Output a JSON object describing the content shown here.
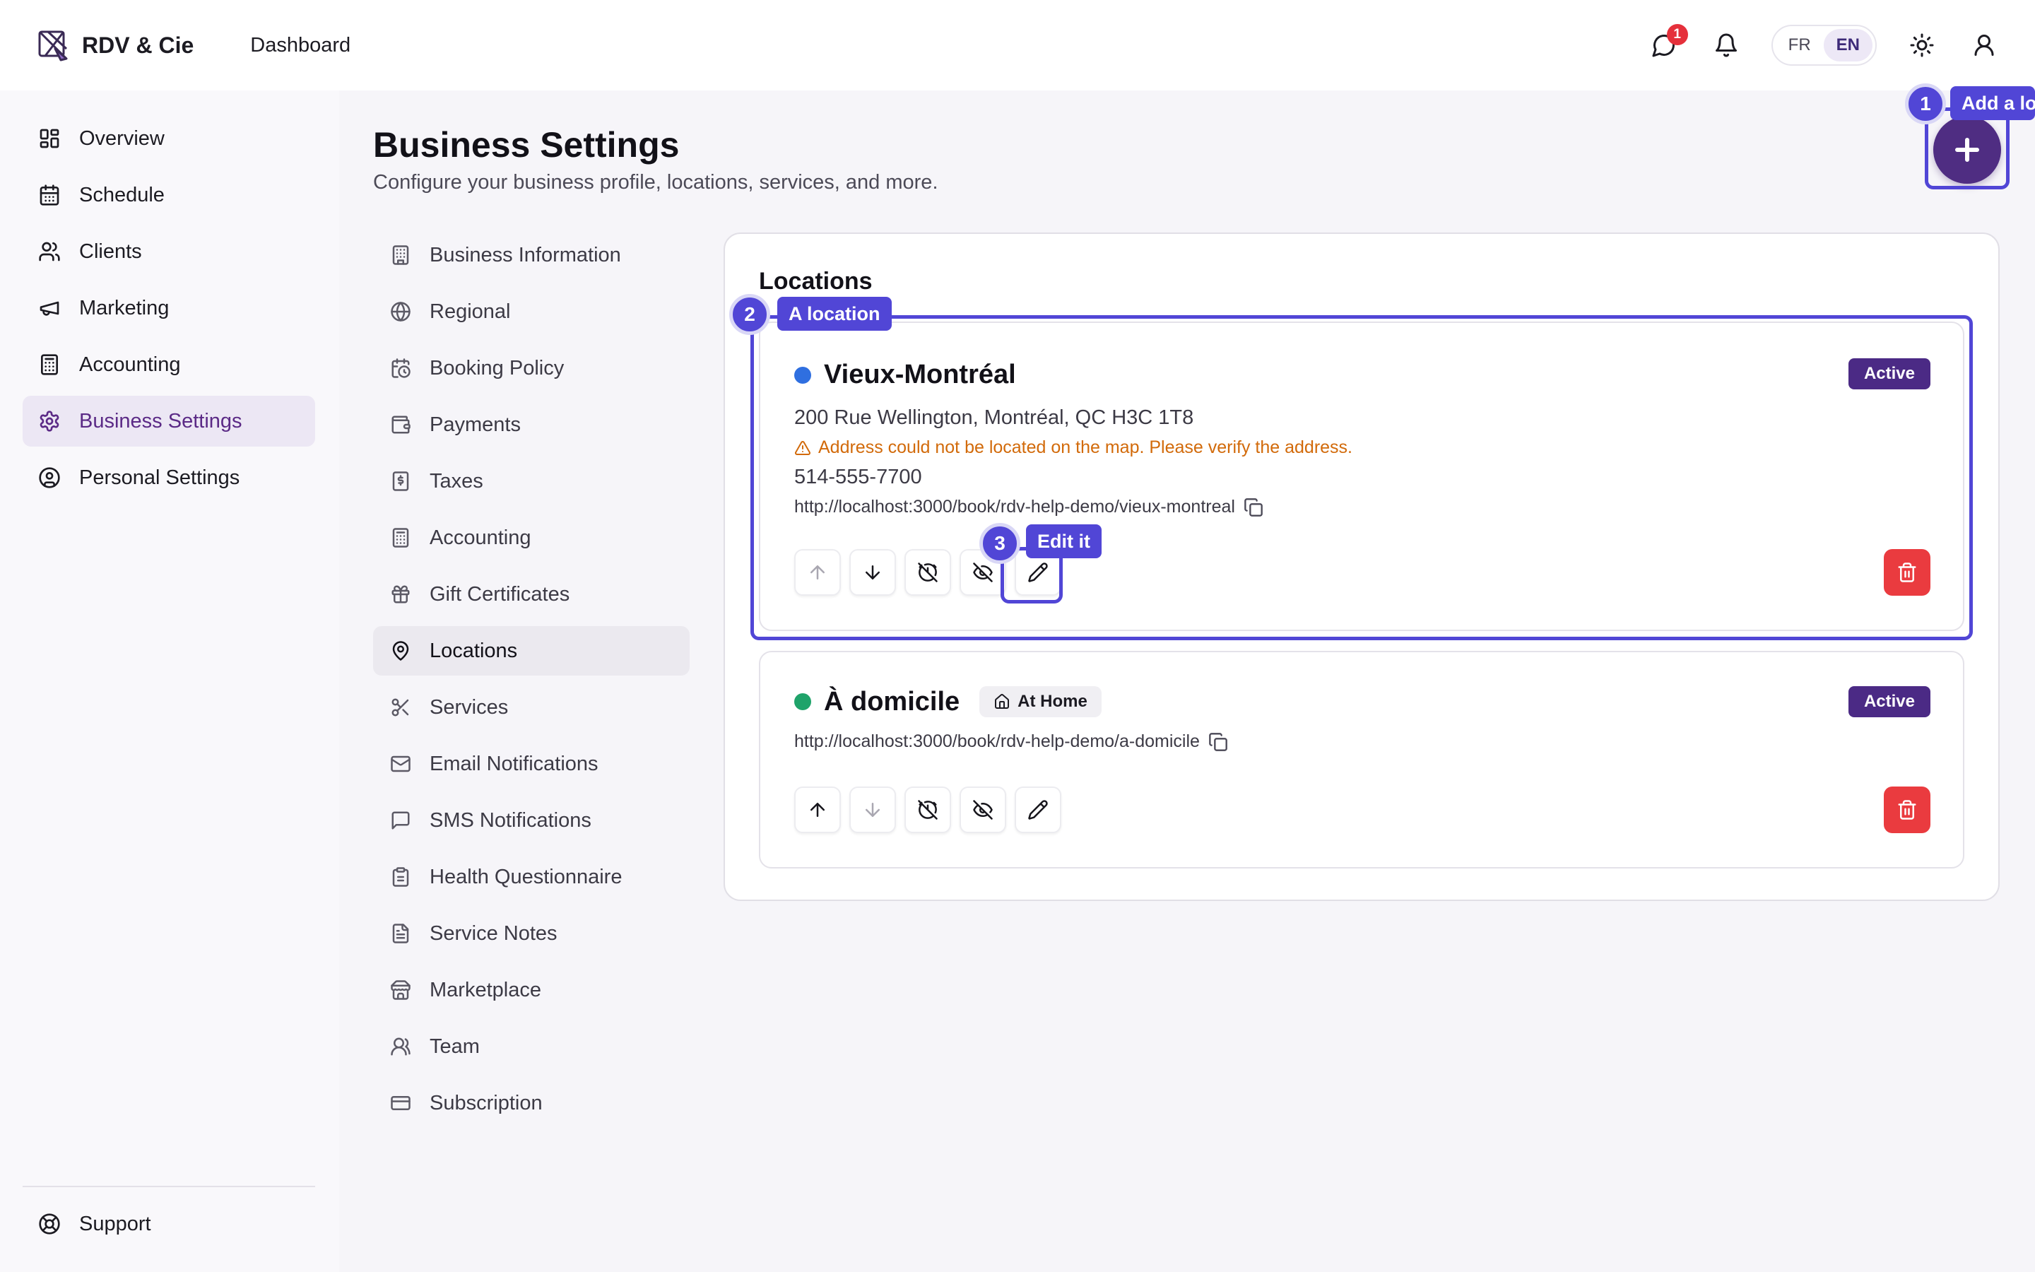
{
  "header": {
    "brand_name": "RDV & Cie",
    "nav_dashboard": "Dashboard",
    "messages_badge": "1",
    "lang_fr": "FR",
    "lang_en": "EN",
    "active_lang": "EN"
  },
  "sidebar": {
    "items": [
      {
        "label": "Overview",
        "icon": "dashboard-icon"
      },
      {
        "label": "Schedule",
        "icon": "calendar-icon"
      },
      {
        "label": "Clients",
        "icon": "users-icon"
      },
      {
        "label": "Marketing",
        "icon": "megaphone-icon"
      },
      {
        "label": "Accounting",
        "icon": "calculator-icon"
      },
      {
        "label": "Business Settings",
        "icon": "gear-icon",
        "active": true
      },
      {
        "label": "Personal Settings",
        "icon": "user-circle-icon"
      }
    ],
    "support_label": "Support"
  },
  "page": {
    "title": "Business Settings",
    "subtitle": "Configure your business profile, locations, services, and more."
  },
  "settings_nav": {
    "items": [
      {
        "label": "Business Information",
        "icon": "building-icon"
      },
      {
        "label": "Regional",
        "icon": "globe-icon"
      },
      {
        "label": "Booking Policy",
        "icon": "calendar-clock-icon"
      },
      {
        "label": "Payments",
        "icon": "wallet-icon"
      },
      {
        "label": "Taxes",
        "icon": "receipt-dollar-icon"
      },
      {
        "label": "Accounting",
        "icon": "calculator-icon"
      },
      {
        "label": "Gift Certificates",
        "icon": "gift-icon"
      },
      {
        "label": "Locations",
        "icon": "map-pin-icon",
        "active": true
      },
      {
        "label": "Services",
        "icon": "scissors-icon"
      },
      {
        "label": "Email Notifications",
        "icon": "mail-icon"
      },
      {
        "label": "SMS Notifications",
        "icon": "message-square-icon"
      },
      {
        "label": "Health Questionnaire",
        "icon": "clipboard-icon"
      },
      {
        "label": "Service Notes",
        "icon": "file-text-icon"
      },
      {
        "label": "Marketplace",
        "icon": "store-icon"
      },
      {
        "label": "Team",
        "icon": "team-icon"
      },
      {
        "label": "Subscription",
        "icon": "credit-card-icon"
      }
    ]
  },
  "locations": {
    "title": "Locations",
    "cards": [
      {
        "name": "Vieux-Montréal",
        "dot_color": "#2f6fe0",
        "status": "Active",
        "address": "200 Rue Wellington, Montréal, QC H3C 1T8",
        "warning": "Address could not be located on the map. Please verify the address.",
        "phone": "514-555-7700",
        "url": "http://localhost:3000/book/rdv-help-demo/vieux-montreal"
      },
      {
        "name": "À domicile",
        "dot_color": "#1fa36a",
        "chip": "At Home",
        "status": "Active",
        "url": "http://localhost:3000/book/rdv-help-demo/a-domicile"
      }
    ]
  },
  "tour": {
    "steps": [
      {
        "number": "1",
        "label": "Add a lo"
      },
      {
        "number": "2",
        "label": "A location"
      },
      {
        "number": "3",
        "label": "Edit it"
      }
    ]
  },
  "colors": {
    "brand_purple": "#4f2d82",
    "active_badge": "#4b2a85",
    "tour_accent": "#5146d6",
    "danger": "#ea3b3f",
    "warning": "#d26a0a"
  }
}
